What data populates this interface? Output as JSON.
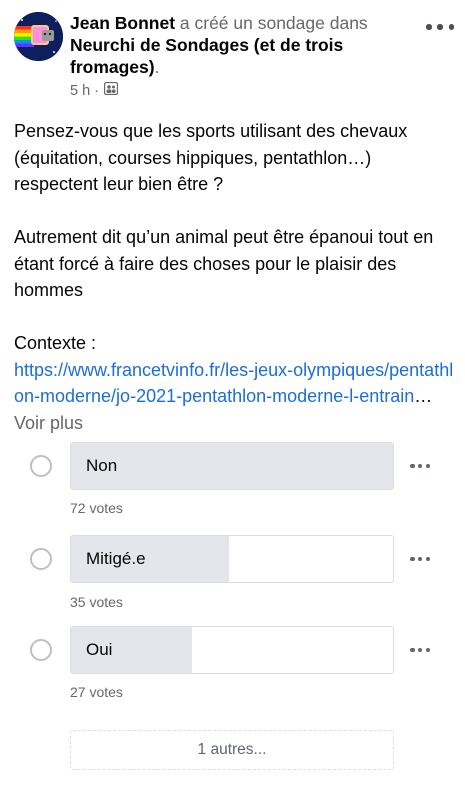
{
  "post": {
    "author": "Jean Bonnet",
    "action": " a créé un sondage dans",
    "group": "Neurchi de Sondages (et de trois fromages)",
    "group_suffix": ".",
    "time": "5 h ·"
  },
  "body": {
    "paragraph1": "Pensez-vous que les sports utilisant des chevaux (équitation, courses hippiques, pentathlon…) respectent leur bien être ?",
    "paragraph2": "Autrement dit qu’un animal peut être épanoui tout en étant forcé à faire des choses pour le plaisir des hommes",
    "context_label": "Contexte :",
    "link": "https://www.francetvinfo.fr/les-jeux-olympiques/pentathlon-moderne/jo-2021-pentathlon-moderne-l-entrain",
    "ellipsis": "…",
    "see_more": "Voir plus"
  },
  "poll": {
    "options": [
      {
        "label": "Non",
        "votes": "72 votes",
        "fill": 1.0
      },
      {
        "label": "Mitigé.e",
        "votes": "35 votes",
        "fill": 0.49
      },
      {
        "label": "Oui",
        "votes": "27 votes",
        "fill": 0.375
      }
    ],
    "more_options": "1 autres..."
  },
  "icons": {
    "more": "more-horizontal-icon",
    "audience": "group-audience-icon",
    "radio": "radio-circle-icon"
  },
  "colors": {
    "link": "#1a6ed8",
    "fill": "#e4e6eb",
    "muted": "#65676b"
  }
}
